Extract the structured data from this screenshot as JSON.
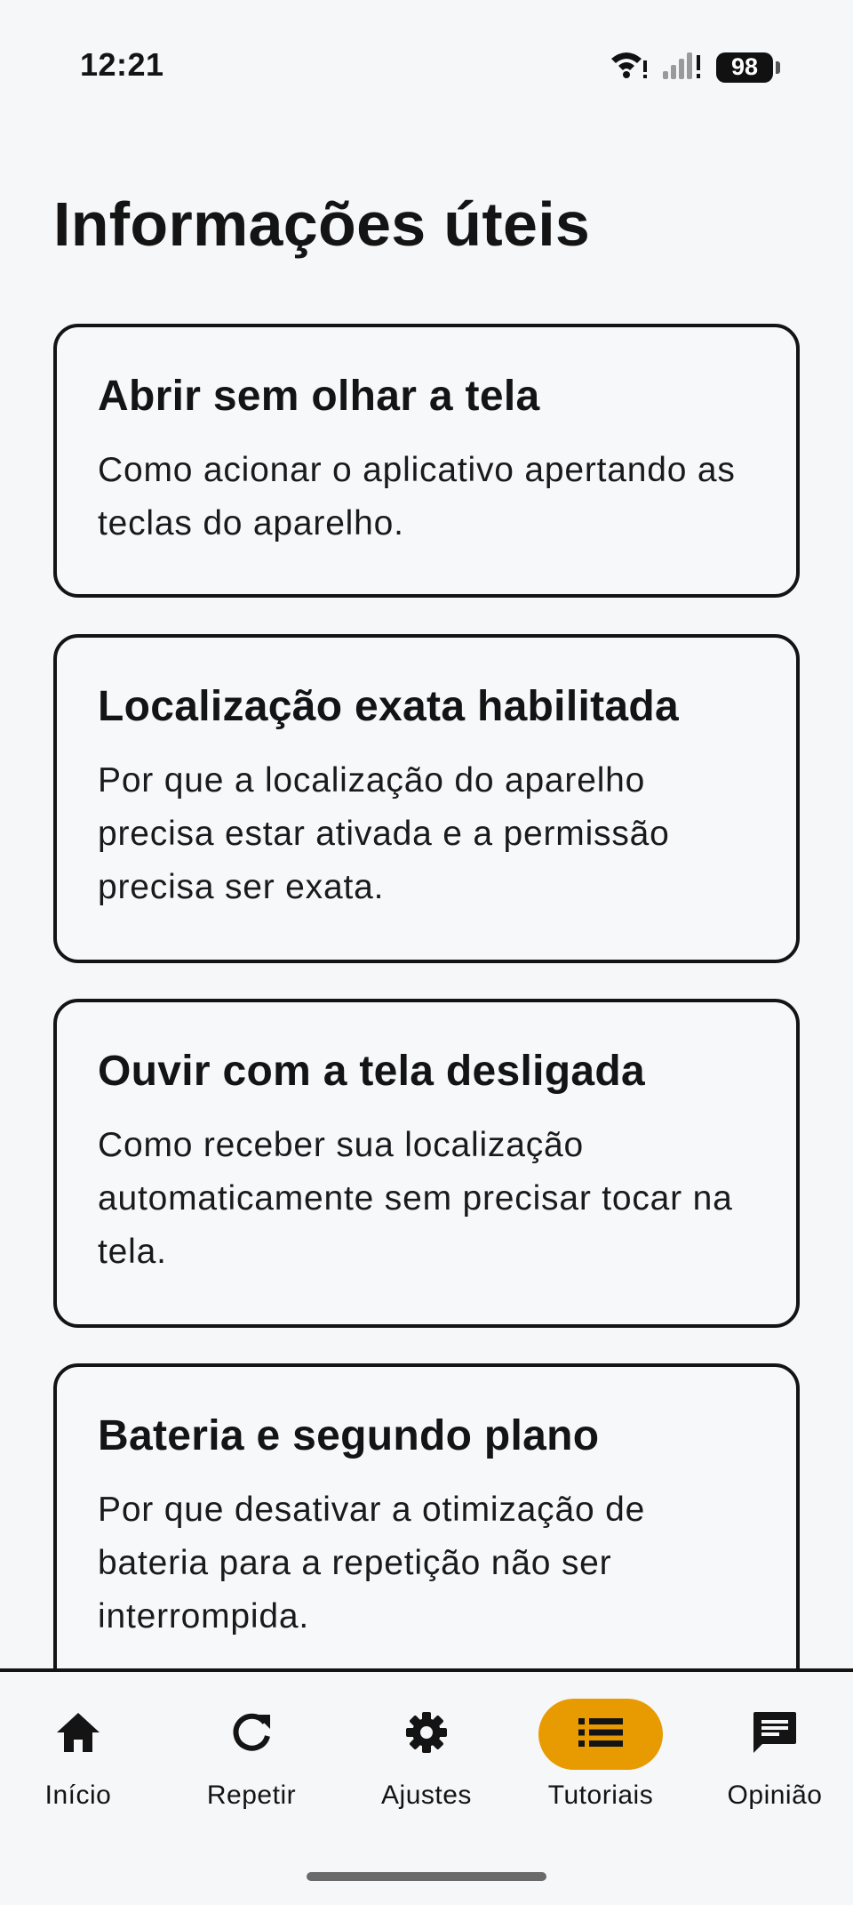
{
  "status_bar": {
    "time": "12:21",
    "battery_level": "98",
    "icons": [
      "wifi-alert-icon",
      "signal-alert-icon",
      "battery-icon"
    ]
  },
  "page": {
    "title": "Informações úteis"
  },
  "cards": [
    {
      "title": "Abrir sem olhar a tela",
      "description": "Como acionar o aplicativo apertando as teclas do aparelho."
    },
    {
      "title": "Localização exata habilitada",
      "description": "Por que a localização do aparelho precisa estar ativada e a permissão precisa ser exata."
    },
    {
      "title": "Ouvir com a tela desligada",
      "description": "Como receber sua localização automaticamente sem precisar tocar na tela."
    },
    {
      "title": "Bateria e segundo plano",
      "description": "Por que desativar a otimização de bateria para a repetição não ser interrompida."
    }
  ],
  "bottom_nav": {
    "active": "Tutoriais",
    "accent_color": "#e89b00",
    "items": [
      {
        "label": "Início",
        "icon": "home-icon"
      },
      {
        "label": "Repetir",
        "icon": "refresh-icon"
      },
      {
        "label": "Ajustes",
        "icon": "gear-icon"
      },
      {
        "label": "Tutoriais",
        "icon": "list-icon"
      },
      {
        "label": "Opinião",
        "icon": "chat-icon"
      }
    ]
  }
}
